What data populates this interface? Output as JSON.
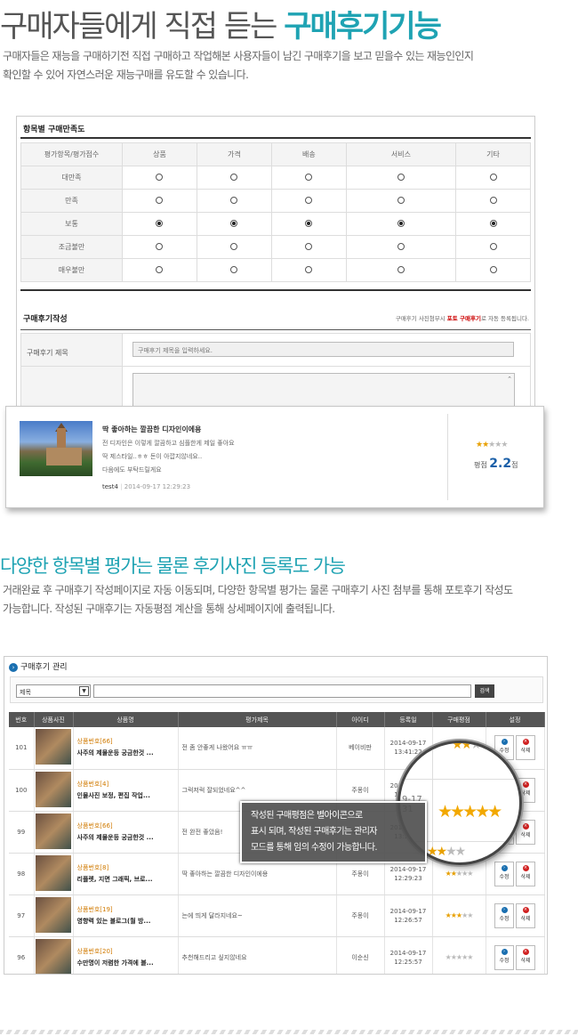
{
  "section1": {
    "heading_plain": "구매자들에게 직접 듣는 ",
    "heading_accent": "구매후기기능",
    "desc_line1": "구매자들은 재능을 구매하기전 직접 구매하고 작업해본 사용자들이 남긴 구매후기을 보고 믿을수 있는 재능인인지",
    "desc_line2": "확인할 수 있어 자연스러운 재능구매를 유도할 수 있습니다."
  },
  "satisfaction": {
    "title": "항목별 구매만족도",
    "header_label": "평가항목/평가점수",
    "columns": [
      "상품",
      "가격",
      "배송",
      "서비스",
      "기타"
    ],
    "rows": [
      {
        "label": "대만족",
        "selected": false
      },
      {
        "label": "만족",
        "selected": false
      },
      {
        "label": "보통",
        "selected": true
      },
      {
        "label": "조금불만",
        "selected": false
      },
      {
        "label": "매우불만",
        "selected": false
      }
    ]
  },
  "write": {
    "title": "구매후기작성",
    "note_before": "구매후기 사진첨부시 ",
    "note_accent": "포토 구매후기",
    "note_after": "로 자동 등록됩니다.",
    "subject_label": "구매후기 제목",
    "subject_placeholder": "구매후기 제목을 입력하세요."
  },
  "review_card": {
    "title": "딱 좋아하는 깔끔한 디자인이에용",
    "lines": [
      "전 디자인은 이렇게 깔끔하고 심플한게 제일 좋아요",
      "딱 제스타일..ㅎㅎ 돈이 아깝지않네요..",
      "다음에도 부탁드릴게요"
    ],
    "author": "test4",
    "sep": "|",
    "date": "2014-09-17 12:29:23",
    "rating": 2.2,
    "score_label": "평점",
    "score_value": "2.2",
    "score_unit": "점"
  },
  "section2": {
    "heading": "다양한 항목별 평가는 물론 후기사진 등록도 가능",
    "desc_line1": "거래완료 후 구매후기 작성페이지로 자동 이동되며, 다양한 항목별 평가는 물론 구매후기 사진 첨부를 통해 포토후기 작성도",
    "desc_line2": "가능합니다. 작성된 구매후기는 자동평점 계산을 통해 상세페이지에 출력됩니다."
  },
  "admin": {
    "title": "구매후기 관리",
    "title_icon": "circle-arrow-icon",
    "select_value": "제목",
    "search_button": "검색",
    "columns": [
      "번호",
      "상품사진",
      "상품명",
      "평가제목",
      "아이디",
      "등록일",
      "구매평점",
      "설정"
    ],
    "edit_label": "수정",
    "delete_label": "삭제",
    "rows": [
      {
        "no": "101",
        "pno": "상품번호[66]",
        "pname": "사주의 제물운등 궁금한것 ...",
        "title": "전 좀 안좋게 나왔어요 ㅠㅠ",
        "user": "베이비판",
        "date1": "2014-09-17",
        "date2": "13:41:22",
        "rating": 3
      },
      {
        "no": "100",
        "pno": "상품번호[4]",
        "pname": "인물사진 보정, 편집 작업...",
        "title": "그럭저럭 잘되었네요^^",
        "user": "주몽이",
        "date1": "2014-09-17",
        "date2": "13:31:22",
        "rating": 5
      },
      {
        "no": "99",
        "pno": "상품번호[66]",
        "pname": "사주의 제물운등 궁금한것 ...",
        "title": "전 완전 좋았음!",
        "user": "주몽이",
        "date1": "2014-09-17",
        "date2": "13:30:10",
        "rating": 4
      },
      {
        "no": "98",
        "pno": "상품번호[8]",
        "pname": "리플렛, 지면 그래픽, 브로...",
        "title": "딱 좋아하는 깔끔한 디자인이에용",
        "user": "주몽이",
        "date1": "2014-09-17",
        "date2": "12:29:23",
        "rating": 2
      },
      {
        "no": "97",
        "pno": "상품번호[19]",
        "pname": "영향력 있는 블로그(월 방...",
        "title": "는에 띄게 달라지네요~",
        "user": "주몽이",
        "date1": "2014-09-17",
        "date2": "12:26:57",
        "rating": 3
      },
      {
        "no": "96",
        "pno": "상품번호[20]",
        "pname": "수만명이 저렴한 가격에 블...",
        "title": "추천해드리고 싶지않네요",
        "user": "이순신",
        "date1": "2014-09-17",
        "date2": "12:25:57",
        "rating": 0
      }
    ]
  },
  "tooltip": {
    "line1": "작성된 구매평점은 별아이콘으로",
    "line2": "표시 되며, 작성된 구매후기는 관리자",
    "line3": "모드를 통해 임의 수정이 가능합니다."
  },
  "magnifier": {
    "date_fragment": "9-17",
    "time_fragment": "31",
    "button_fragment": "수"
  },
  "colors": {
    "accent": "#1fa3b3",
    "star": "#e8a000",
    "link_blue": "#1a5fa8",
    "red": "#cc0000"
  }
}
